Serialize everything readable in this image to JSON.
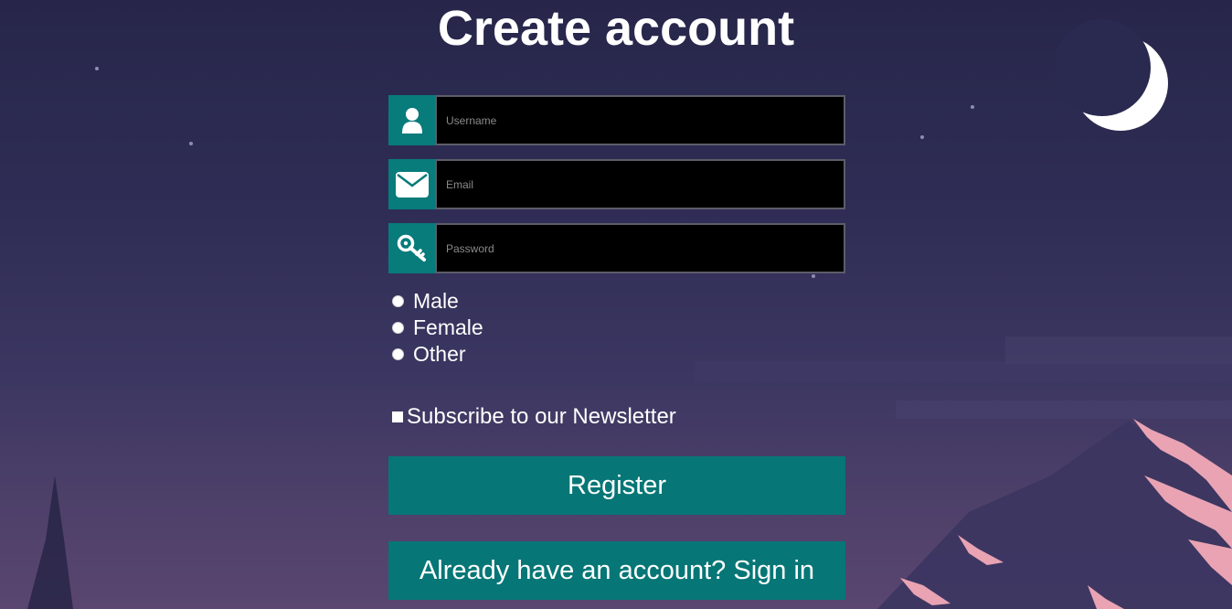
{
  "page": {
    "title": "Create account"
  },
  "form": {
    "username": {
      "placeholder": "Username",
      "value": "",
      "icon": "user-icon"
    },
    "email": {
      "placeholder": "Email",
      "value": "",
      "icon": "envelope-icon"
    },
    "password": {
      "placeholder": "Password",
      "value": "",
      "icon": "key-icon"
    }
  },
  "gender": {
    "options": [
      "Male",
      "Female",
      "Other"
    ]
  },
  "newsletter": {
    "label": "Subscribe to our Newsletter"
  },
  "buttons": {
    "register_label": "Register",
    "signin_label": "Already have an account? Sign in"
  },
  "colors": {
    "accent": "#077676",
    "input_bg": "#000000",
    "background_top": "#27264a",
    "background_bottom": "#5a4670",
    "mountain": "#e9a3b3"
  }
}
